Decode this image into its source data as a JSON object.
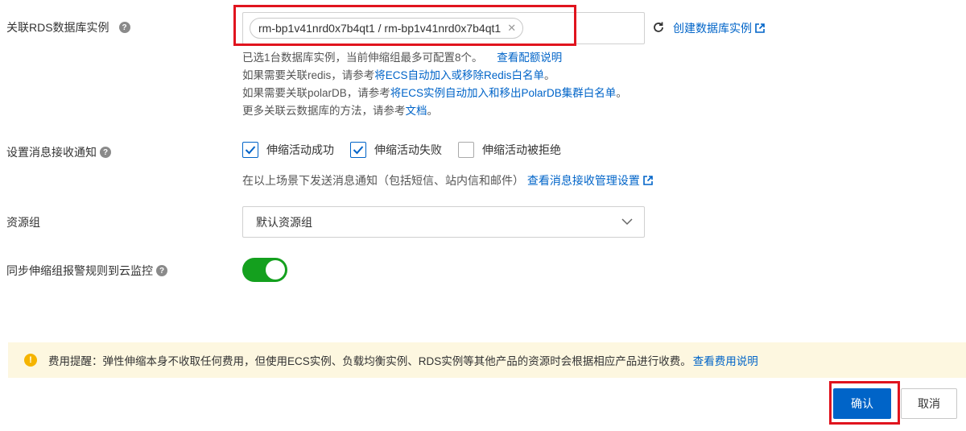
{
  "rds": {
    "label": "关联RDS数据库实例",
    "selected_tag": "rm-bp1v41nrd0x7b4qt1 / rm-bp1v41nrd0x7b4qt1",
    "create_link": "创建数据库实例",
    "hint1": "已选1台数据库实例，当前伸缩组最多可配置8个。",
    "hint1_link": "查看配额说明",
    "hint2_prefix": "如果需要关联redis，请参考",
    "hint2_link": "将ECS自动加入或移除Redis白名单",
    "hint2_suffix": "。",
    "hint3_prefix": "如果需要关联polarDB，请参考",
    "hint3_link": "将ECS实例自动加入和移出PolarDB集群白名单",
    "hint3_suffix": "。",
    "hint4_prefix": "更多关联云数据库的方法，请参考",
    "hint4_link": "文档",
    "hint4_suffix": "。"
  },
  "notify": {
    "label": "设置消息接收通知",
    "options": [
      {
        "label": "伸缩活动成功",
        "checked": true
      },
      {
        "label": "伸缩活动失败",
        "checked": true
      },
      {
        "label": "伸缩活动被拒绝",
        "checked": false
      }
    ],
    "hint": "在以上场景下发送消息通知（包括短信、站内信和邮件）",
    "hint_link": "查看消息接收管理设置"
  },
  "resource_group": {
    "label": "资源组",
    "value": "默认资源组"
  },
  "sync_alarm": {
    "label": "同步伸缩组报警规则到云监控",
    "enabled": true
  },
  "notice": {
    "title": "费用提醒：",
    "text": "弹性伸缩本身不收取任何费用，但使用ECS实例、负载均衡实例、RDS实例等其他产品的资源时会根据相应产品进行收费。",
    "link": "查看费用说明"
  },
  "buttons": {
    "confirm": "确认",
    "cancel": "取消"
  },
  "colors": {
    "primary": "#0064c8",
    "highlight": "#e0141e",
    "switch_on": "#14a01e",
    "notice_bg": "#fdf7e0",
    "warning": "#f5b400"
  },
  "icons": {
    "help": "question-circle-icon",
    "refresh": "refresh-icon",
    "external": "external-link-icon",
    "warning": "warning-circle-icon",
    "chevron": "chevron-down-icon"
  }
}
